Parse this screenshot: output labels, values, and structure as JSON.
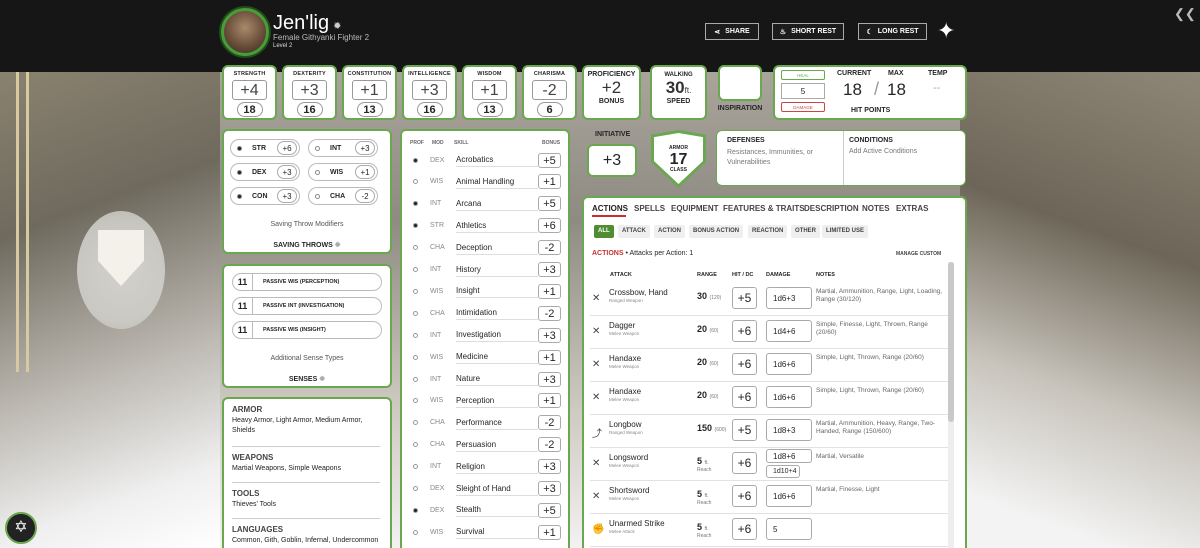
{
  "header": {
    "name": "Jen'lig",
    "subtitle": "Female  Githyanki  Fighter 2",
    "level": "Level 2",
    "share": "SHARE",
    "short_rest": "SHORT REST",
    "long_rest": "LONG REST"
  },
  "abilities": [
    {
      "label": "STRENGTH",
      "mod": "+4",
      "score": "18"
    },
    {
      "label": "DEXTERITY",
      "mod": "+3",
      "score": "16"
    },
    {
      "label": "CONSTITUTION",
      "mod": "+1",
      "score": "13"
    },
    {
      "label": "INTELLIGENCE",
      "mod": "+3",
      "score": "16"
    },
    {
      "label": "WISDOM",
      "mod": "+1",
      "score": "13"
    },
    {
      "label": "CHARISMA",
      "mod": "-2",
      "score": "6"
    }
  ],
  "proficiency": {
    "top": "PROFICIENCY",
    "value": "+2",
    "bottom": "BONUS"
  },
  "speed": {
    "top": "WALKING",
    "value": "30",
    "unit": "ft.",
    "bottom": "SPEED"
  },
  "inspiration": "INSPIRATION",
  "hp": {
    "heal": "HEAL",
    "input": "5",
    "damage": "DAMAGE",
    "current_label": "CURRENT",
    "max_label": "MAX",
    "temp_label": "TEMP",
    "current": "18",
    "slash": "/",
    "max": "18",
    "temp": "--",
    "title": "HIT POINTS"
  },
  "initiative": {
    "label": "INITIATIVE",
    "value": "+3"
  },
  "armor": {
    "top": "ARMOR",
    "value": "17",
    "bottom": "CLASS"
  },
  "defenses": {
    "title": "DEFENSES",
    "text": "Resistances, Immunities, or Vulnerabilities"
  },
  "conditions": {
    "title": "CONDITIONS",
    "text": "Add Active Conditions"
  },
  "saves": [
    {
      "abbr": "STR",
      "val": "+6",
      "prof": true
    },
    {
      "abbr": "INT",
      "val": "+3",
      "prof": false
    },
    {
      "abbr": "DEX",
      "val": "+3",
      "prof": true
    },
    {
      "abbr": "WIS",
      "val": "+1",
      "prof": false
    },
    {
      "abbr": "CON",
      "val": "+3",
      "prof": true
    },
    {
      "abbr": "CHA",
      "val": "-2",
      "prof": false
    }
  ],
  "saves_modifiers": "Saving Throw Modifiers",
  "saves_title": "SAVING THROWS",
  "passives": [
    {
      "val": "11",
      "label": "PASSIVE WIS (PERCEPTION)"
    },
    {
      "val": "11",
      "label": "PASSIVE INT (INVESTIGATION)"
    },
    {
      "val": "11",
      "label": "PASSIVE WIS (INSIGHT)"
    }
  ],
  "senses_add": "Additional Sense Types",
  "senses_title": "SENSES",
  "proficiencies": [
    {
      "title": "ARMOR",
      "text": "Heavy Armor, Light Armor, Medium Armor, Shields"
    },
    {
      "title": "WEAPONS",
      "text": "Martial Weapons, Simple Weapons"
    },
    {
      "title": "TOOLS",
      "text": "Thieves' Tools"
    },
    {
      "title": "LANGUAGES",
      "text": "Common, Gith, Goblin, Infernal, Undercommon"
    }
  ],
  "skills_headers": {
    "prof": "PROF",
    "mod": "MOD",
    "skill": "SKILL",
    "bonus": "BONUS"
  },
  "skills": [
    {
      "mod": "DEX",
      "name": "Acrobatics",
      "bonus": "+5",
      "prof": true
    },
    {
      "mod": "WIS",
      "name": "Animal Handling",
      "bonus": "+1",
      "prof": false
    },
    {
      "mod": "INT",
      "name": "Arcana",
      "bonus": "+5",
      "prof": true
    },
    {
      "mod": "STR",
      "name": "Athletics",
      "bonus": "+6",
      "prof": true
    },
    {
      "mod": "CHA",
      "name": "Deception",
      "bonus": "-2",
      "prof": false
    },
    {
      "mod": "INT",
      "name": "History",
      "bonus": "+3",
      "prof": false
    },
    {
      "mod": "WIS",
      "name": "Insight",
      "bonus": "+1",
      "prof": false
    },
    {
      "mod": "CHA",
      "name": "Intimidation",
      "bonus": "-2",
      "prof": false
    },
    {
      "mod": "INT",
      "name": "Investigation",
      "bonus": "+3",
      "prof": false
    },
    {
      "mod": "WIS",
      "name": "Medicine",
      "bonus": "+1",
      "prof": false
    },
    {
      "mod": "INT",
      "name": "Nature",
      "bonus": "+3",
      "prof": false
    },
    {
      "mod": "WIS",
      "name": "Perception",
      "bonus": "+1",
      "prof": false
    },
    {
      "mod": "CHA",
      "name": "Performance",
      "bonus": "-2",
      "prof": false
    },
    {
      "mod": "CHA",
      "name": "Persuasion",
      "bonus": "-2",
      "prof": false
    },
    {
      "mod": "INT",
      "name": "Religion",
      "bonus": "+3",
      "prof": false
    },
    {
      "mod": "DEX",
      "name": "Sleight of Hand",
      "bonus": "+3",
      "prof": false
    },
    {
      "mod": "DEX",
      "name": "Stealth",
      "bonus": "+5",
      "prof": true
    },
    {
      "mod": "WIS",
      "name": "Survival",
      "bonus": "+1",
      "prof": false
    }
  ],
  "tabs": [
    "ACTIONS",
    "SPELLS",
    "EQUIPMENT",
    "FEATURES & TRAITS",
    "DESCRIPTION",
    "NOTES",
    "EXTRAS"
  ],
  "subtabs": [
    "ALL",
    "ATTACK",
    "ACTION",
    "BONUS ACTION",
    "REACTION",
    "OTHER",
    "LIMITED USE"
  ],
  "actions_label": "ACTIONS",
  "attacks_per_action": "• Attacks per Action: 1",
  "manage_custom": "MANAGE CUSTOM",
  "attack_headers": {
    "attack": "ATTACK",
    "range": "RANGE",
    "hit": "HIT / DC",
    "damage": "DAMAGE",
    "notes": "NOTES"
  },
  "attacks": [
    {
      "name": "Crossbow, Hand",
      "type": "Ranged Weapon",
      "range": "30",
      "range_long": "(120)",
      "reach": "",
      "hit": "+5",
      "damage": "1d6+3",
      "damage2": "",
      "notes": "Martial, Ammunition, Range, Light, Loading, Range (30/120)",
      "icon": "crossbow-icon"
    },
    {
      "name": "Dagger",
      "type": "Melee Weapon",
      "range": "20",
      "range_long": "(60)",
      "reach": "",
      "hit": "+6",
      "damage": "1d4+6",
      "damage2": "",
      "notes": "Simple, Finesse, Light, Thrown, Range (20/60)",
      "icon": "dagger-icon"
    },
    {
      "name": "Handaxe",
      "type": "Melee Weapon",
      "range": "20",
      "range_long": "(60)",
      "reach": "",
      "hit": "+6",
      "damage": "1d6+6",
      "damage2": "",
      "notes": "Simple, Light, Thrown, Range (20/60)",
      "icon": "handaxe-icon"
    },
    {
      "name": "Handaxe",
      "type": "Melee Weapon",
      "range": "20",
      "range_long": "(60)",
      "reach": "",
      "hit": "+6",
      "damage": "1d6+6",
      "damage2": "",
      "notes": "Simple, Light, Thrown, Range (20/60)",
      "icon": "handaxe-icon"
    },
    {
      "name": "Longbow",
      "type": "Ranged Weapon",
      "range": "150",
      "range_long": "(600)",
      "reach": "",
      "hit": "+5",
      "damage": "1d8+3",
      "damage2": "",
      "notes": "Martial, Ammunition, Heavy, Range, Two-Handed, Range (150/600)",
      "icon": "bow-icon"
    },
    {
      "name": "Longsword",
      "type": "Melee Weapon",
      "range": "5",
      "range_long": "ft.",
      "reach": "Reach",
      "hit": "+6",
      "damage": "1d8+6",
      "damage2": "1d10+4",
      "notes": "Martial, Versatile",
      "icon": "sword-icon"
    },
    {
      "name": "Shortsword",
      "type": "Melee Weapon",
      "range": "5",
      "range_long": "ft.",
      "reach": "Reach",
      "hit": "+6",
      "damage": "1d6+6",
      "damage2": "",
      "notes": "Martial, Finesse, Light",
      "icon": "sword-icon"
    },
    {
      "name": "Unarmed Strike",
      "type": "Melee Attack",
      "range": "5",
      "range_long": "ft.",
      "reach": "Reach",
      "hit": "+6",
      "damage": "5",
      "damage2": "",
      "notes": "",
      "icon": "fist-icon"
    }
  ]
}
